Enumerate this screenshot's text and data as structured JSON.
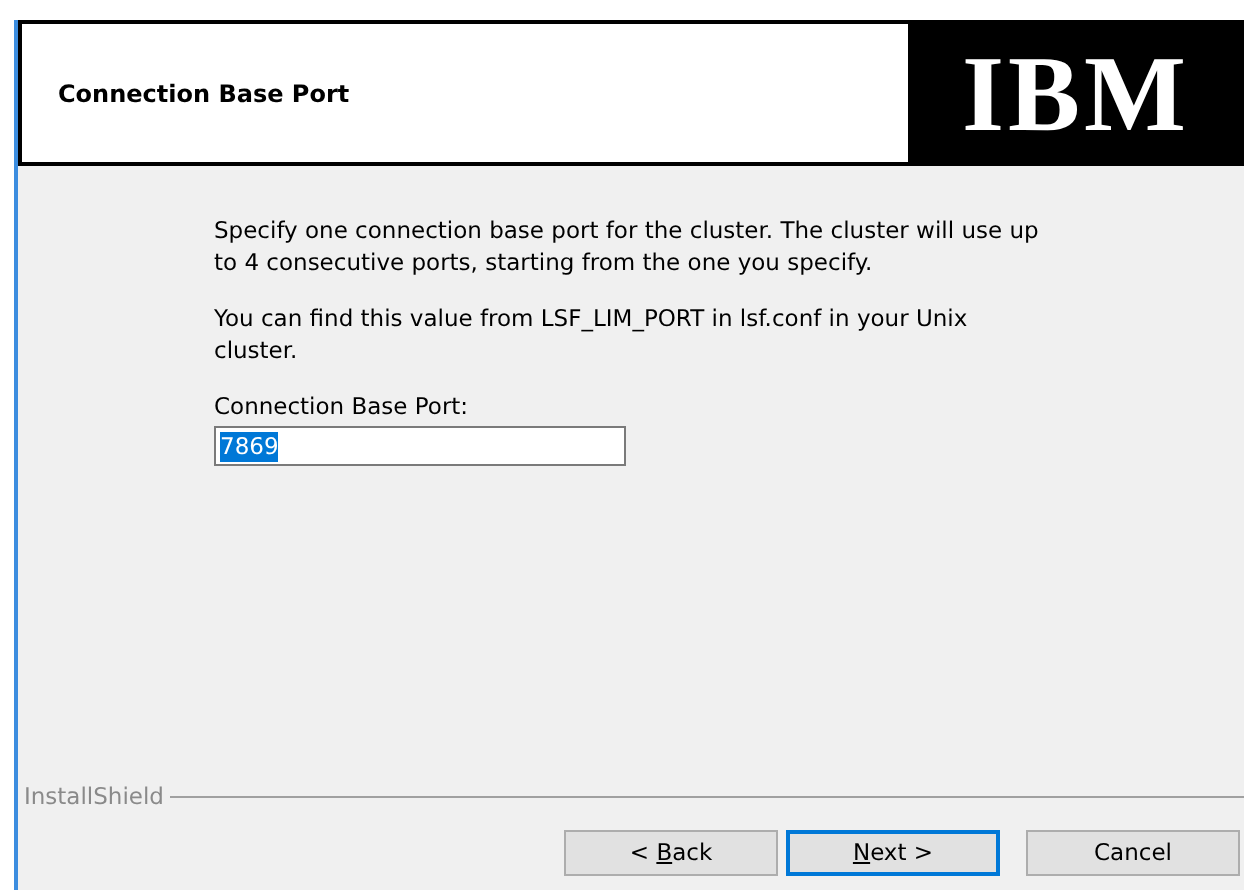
{
  "header": {
    "title": "Connection Base Port",
    "logo": "IBM"
  },
  "body": {
    "paragraphs": [
      "Specify one connection base port for the cluster. The cluster will use up to 4 consecutive ports, starting from the one you specify.",
      "You can find this value from LSF_LIM_PORT in lsf.conf in your Unix cluster."
    ],
    "field": {
      "label": "Connection Base Port:",
      "value": "7869",
      "selected": true
    }
  },
  "footer": {
    "brand": "InstallShield",
    "buttons": [
      {
        "label": "< Back",
        "shortcut_underlined": true,
        "default": false
      },
      {
        "label": "Next >",
        "shortcut_underlined": true,
        "default": true
      },
      {
        "label": "Cancel",
        "shortcut_underlined": false,
        "default": false
      }
    ]
  }
}
